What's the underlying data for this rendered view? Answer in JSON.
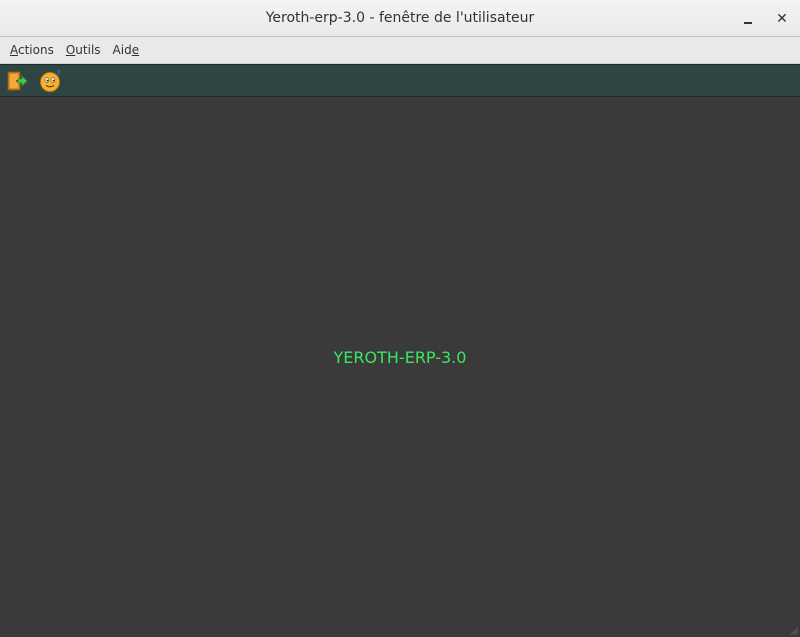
{
  "window": {
    "title": "Yeroth-erp-3.0 - fenêtre de l'utilisateur",
    "minimize_glyph": "_",
    "close_glyph": "✕"
  },
  "menubar": {
    "items": [
      {
        "mnemonic": "A",
        "rest": "ctions"
      },
      {
        "mnemonic": "O",
        "rest": "utils"
      },
      {
        "pre": "Aid",
        "mnemonic": "e"
      }
    ]
  },
  "toolbar": {
    "buttons": [
      {
        "icon": "exit-door-icon"
      },
      {
        "icon": "help-smiley-icon"
      }
    ]
  },
  "content": {
    "label": "YEROTH-ERP-3.0",
    "label_color": "#39e75f"
  },
  "colors": {
    "background": "#3a3a3a",
    "toolbar": "#2f4544",
    "menubar": "#e9e9e7"
  }
}
